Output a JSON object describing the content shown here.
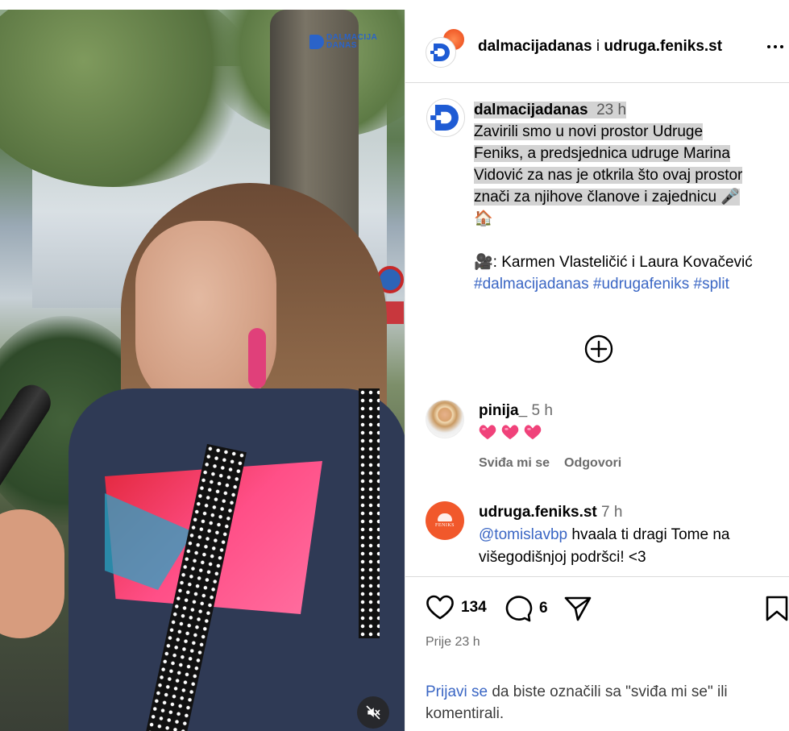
{
  "video": {
    "overlay_logo_line1": "DALMACIJA",
    "overlay_logo_line2": "DANAS",
    "mute_icon": "muted-speaker-icon"
  },
  "header": {
    "user1": "dalmacijadanas",
    "separator": "i",
    "user2": "udruga.feniks.st",
    "more_icon": "more-options-icon"
  },
  "caption": {
    "username": "dalmacijadanas",
    "time": "23 h",
    "text_lines": [
      "Zavirili smo u novi prostor Udruge",
      "Feniks, a predsjednica udruge Marina",
      "Vidović za nas je otkrila što ovaj prostor",
      "znači za njihove članove i zajednicu 🎤"
    ],
    "house_emoji": "🏠",
    "credits": "🎥: Karmen Vlasteličić i Laura Kovačević",
    "hashtags": "#dalmacijadanas #udrugafeniks #split"
  },
  "comments": [
    {
      "username": "pinija_",
      "time": "5 h",
      "content": "❤️❤️❤️",
      "like_label": "Sviđa mi se",
      "reply_label": "Odgovori"
    },
    {
      "username": "udruga.feniks.st",
      "time": "7 h",
      "mention": "@tomislavbp",
      "text_line1": " hvaala ti dragi Tome na",
      "text_line2": "višegodišnjoj podršci! <3",
      "avatar_text": "FENIKS"
    }
  ],
  "actions": {
    "like_count": "134",
    "comment_count": "6",
    "posted": "Prije 23 h"
  },
  "login": {
    "link": "Prijavi se",
    "rest": " da biste označili sa \"sviđa mi se\" ili komentirali."
  },
  "colors": {
    "link_blue": "#3a66c4",
    "heart_pink": "#f0427a",
    "feniks_orange": "#f1582b",
    "brand_blue": "#1e5bd4"
  }
}
